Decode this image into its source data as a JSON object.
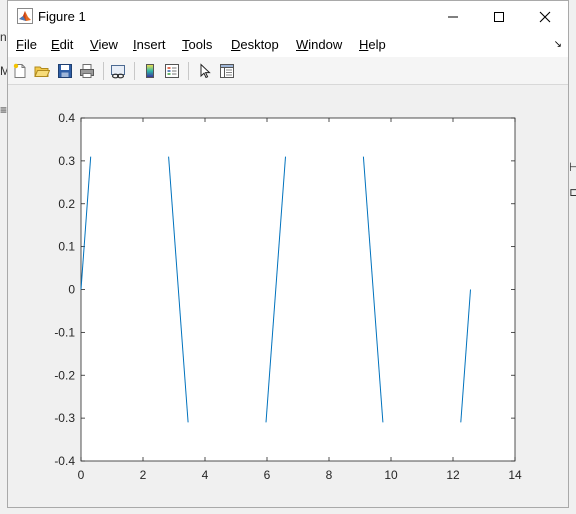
{
  "window": {
    "title": "Figure 1"
  },
  "menu": {
    "items": [
      {
        "key": "file",
        "label_ul": "F",
        "label_rest": "ile"
      },
      {
        "key": "edit",
        "label_ul": "E",
        "label_rest": "dit"
      },
      {
        "key": "view",
        "label_ul": "V",
        "label_rest": "iew"
      },
      {
        "key": "insert",
        "label_ul": "I",
        "label_rest": "nsert"
      },
      {
        "key": "tools",
        "label_ul": "T",
        "label_rest": "ools"
      },
      {
        "key": "desktop",
        "label_ul": "D",
        "label_rest": "esktop"
      },
      {
        "key": "window",
        "label_ul": "W",
        "label_rest": "indow"
      },
      {
        "key": "help",
        "label_ul": "H",
        "label_rest": "elp"
      }
    ],
    "overflow_arrow": "↘"
  },
  "toolbar": {
    "icons": [
      "new-figure-icon",
      "open-file-icon",
      "save-icon",
      "print-icon",
      "link-plot-icon",
      "colorbar-icon",
      "legend-icon",
      "edit-plot-icon",
      "property-inspector-icon"
    ]
  },
  "chart_data": {
    "type": "line",
    "title": "",
    "xlabel": "",
    "ylabel": "",
    "xlim": [
      0,
      14
    ],
    "ylim": [
      -0.4,
      0.4
    ],
    "xticks": [
      "0",
      "2",
      "4",
      "6",
      "8",
      "10",
      "12",
      "14"
    ],
    "yticks": [
      "0.4",
      "0.3",
      "0.2",
      "0.1",
      "0",
      "-0.1",
      "-0.2",
      "-0.3",
      "-0.4"
    ],
    "grid": false,
    "line_color": "#0072bd",
    "series": [
      {
        "x": [
          0,
          0.314,
          null,
          2.827,
          3.456,
          null,
          5.969,
          6.597,
          null,
          9.11,
          9.739,
          null,
          12.252,
          12.566
        ],
        "y": [
          0,
          0.31,
          null,
          0.31,
          -0.31,
          null,
          -0.31,
          0.31,
          null,
          0.31,
          -0.31,
          null,
          -0.31,
          0
        ]
      }
    ]
  }
}
